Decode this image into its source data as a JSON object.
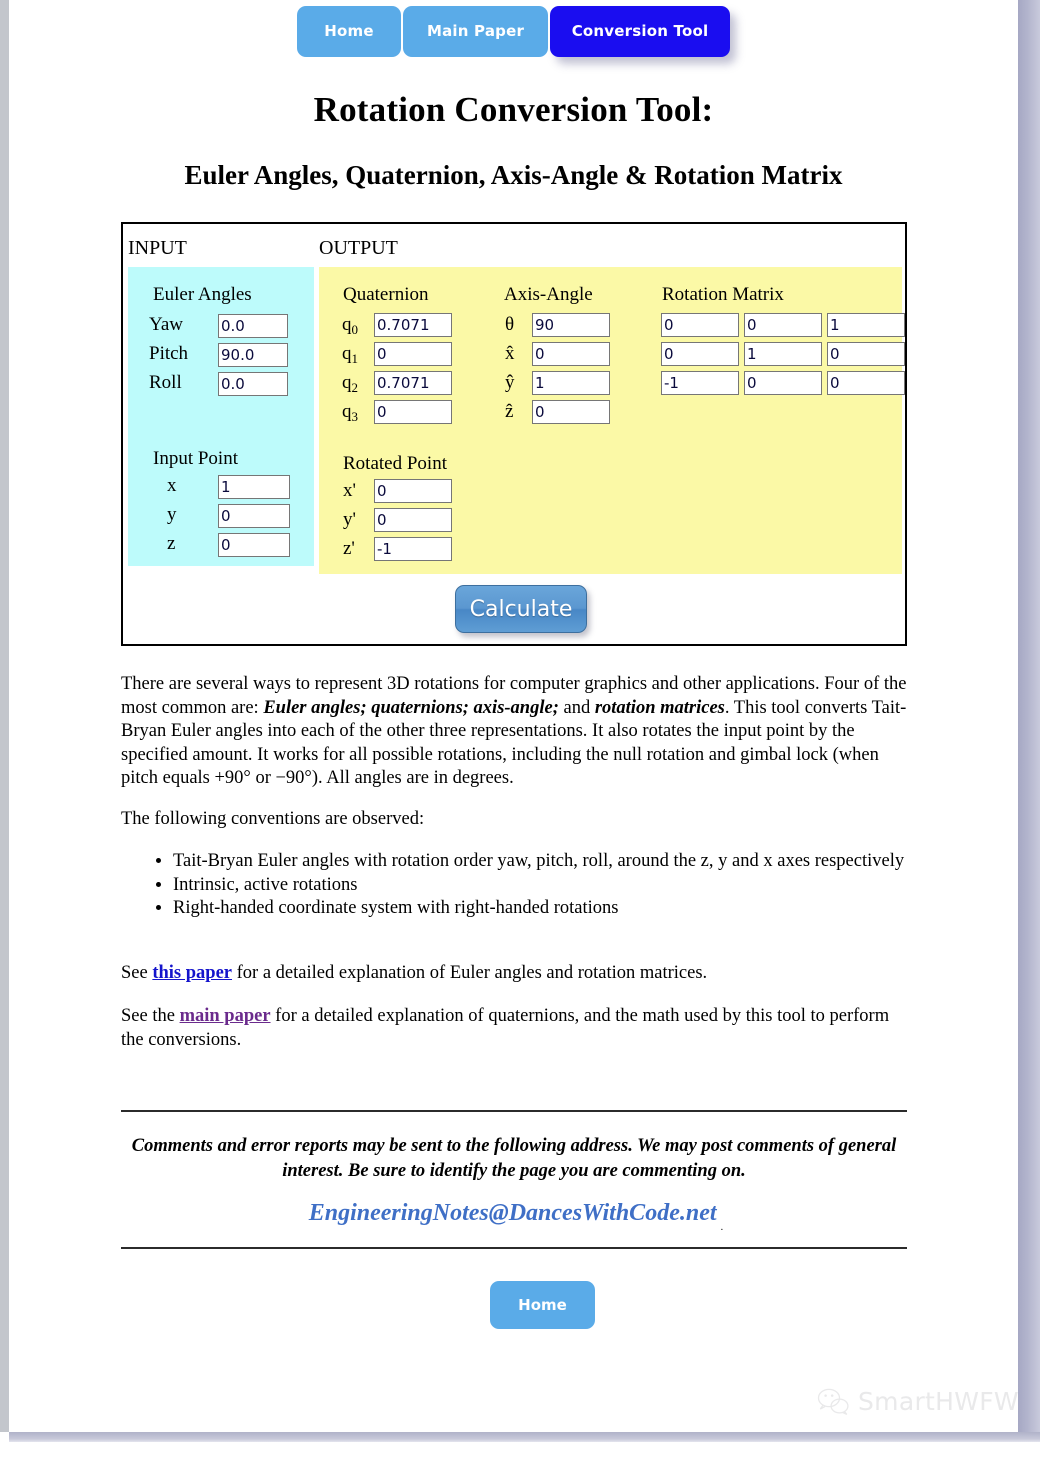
{
  "nav": {
    "items": [
      {
        "id": "home",
        "label": "Home",
        "active": false
      },
      {
        "id": "main-paper",
        "label": "Main Paper",
        "active": false
      },
      {
        "id": "conversion-tool",
        "label": "Conversion Tool",
        "active": true
      }
    ]
  },
  "headings": {
    "title": "Rotation Conversion Tool:",
    "subtitle": "Euler Angles, Quaternion, Axis-Angle & Rotation Matrix"
  },
  "tool": {
    "input_label": "INPUT",
    "output_label": "OUTPUT",
    "euler": {
      "title": "Euler Angles",
      "rows": [
        {
          "label": "Yaw",
          "value": "0.0"
        },
        {
          "label": "Pitch",
          "value": "90.0"
        },
        {
          "label": "Roll",
          "value": "0.0"
        }
      ]
    },
    "input_point": {
      "title": "Input Point",
      "rows": [
        {
          "label": "x",
          "value": "1"
        },
        {
          "label": "y",
          "value": "0"
        },
        {
          "label": "z",
          "value": "0"
        }
      ]
    },
    "quaternion": {
      "title": "Quaternion",
      "rows": [
        {
          "label": "q",
          "sub": "0",
          "value": "0.7071"
        },
        {
          "label": "q",
          "sub": "1",
          "value": "0"
        },
        {
          "label": "q",
          "sub": "2",
          "value": "0.7071"
        },
        {
          "label": "q",
          "sub": "3",
          "value": "0"
        }
      ]
    },
    "axis_angle": {
      "title": "Axis-Angle",
      "rows": [
        {
          "label": "θ",
          "value": "90"
        },
        {
          "label": "x̂",
          "value": "0"
        },
        {
          "label": "ŷ",
          "value": "1"
        },
        {
          "label": "ẑ",
          "value": "0"
        }
      ]
    },
    "rotation_matrix": {
      "title": "Rotation Matrix",
      "rows": [
        [
          "0",
          "0",
          "1"
        ],
        [
          "0",
          "1",
          "0"
        ],
        [
          "-1",
          "0",
          "0"
        ]
      ]
    },
    "rotated_point": {
      "title": "Rotated Point",
      "rows": [
        {
          "label": "x'",
          "value": "0"
        },
        {
          "label": "y'",
          "value": "0"
        },
        {
          "label": "z'",
          "value": "-1"
        }
      ]
    },
    "calculate_label": "Calculate"
  },
  "body": {
    "intro_1": "There are several ways to represent 3D rotations for computer graphics and other applications. Four of the most common are: ",
    "intro_em1": "Euler angles; quaternions; axis-angle;",
    "intro_2": " and ",
    "intro_em2": "rotation matrices",
    "intro_3": ". This tool converts Tait-Bryan Euler angles into each of the other three representations. It also rotates the input point by the specified amount. It works for all possible rotations, including the null rotation and gimbal lock (when pitch equals +90° or −90°). All angles are in degrees.",
    "conventions_lead": "The following conventions are observed:",
    "bullets": [
      "Tait-Bryan Euler angles with rotation order yaw, pitch, roll, around the z, y and x axes respectively",
      "Intrinsic, active rotations",
      "Right-handed coordinate system with right-handed rotations"
    ],
    "link1_pre": "See ",
    "link1_text": "this paper",
    "link1_post": " for a detailed explanation of Euler angles and rotation matrices.",
    "link2_pre": "See the ",
    "link2_text": "main paper",
    "link2_post": " for a detailed explanation of quaternions, and the math used by this tool to perform the conversions."
  },
  "footer": {
    "note": "Comments and error reports may be sent to the following address. We may post comments of general interest. Be sure to identify the page you are commenting on.",
    "email": "EngineeringNotes@DancesWithCode.net",
    "email_trailing_dot": ".",
    "home_label": "Home"
  },
  "watermark": {
    "text": "SmartHWFW",
    "icon": "wechat-icon"
  },
  "colors": {
    "nav_inactive": "#5aabe8",
    "nav_active": "#1a0df0",
    "input_panel": "#bdfbfb",
    "output_panel": "#fbf9a6",
    "link_blue": "#1414cc",
    "link_purple": "#6a2a8c",
    "email_blue": "#3f6fc6"
  }
}
